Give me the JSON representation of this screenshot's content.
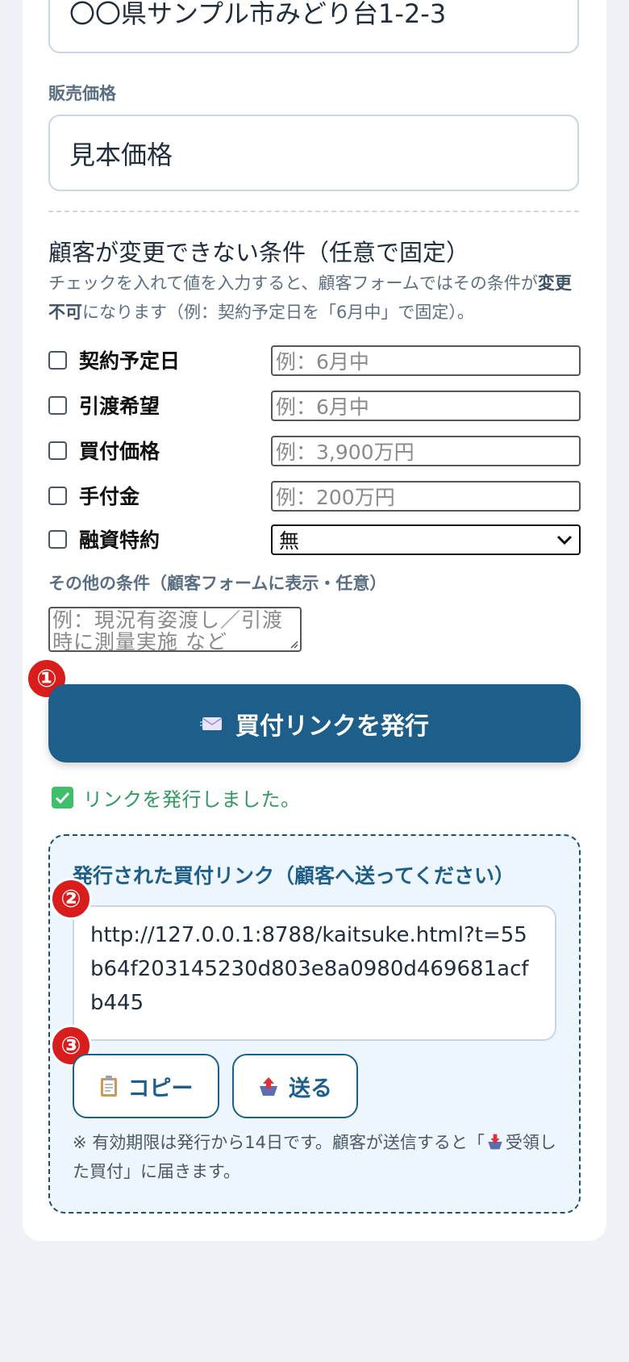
{
  "address_field": {
    "value": "〇〇県サンプル市みどり台1-2-3"
  },
  "price": {
    "label": "販売価格",
    "value": "見本価格"
  },
  "fixed_conditions": {
    "title": "顧客が変更できない条件（任意で固定）",
    "desc_part1": "チェックを入れて値を入力すると、顧客フォームではその条件が",
    "desc_bold": "変更不可",
    "desc_part2": "になります（例：契約予定日を「6月中」で固定）。",
    "items": [
      {
        "label": "契約予定日",
        "placeholder": "例：6月中"
      },
      {
        "label": "引渡希望",
        "placeholder": "例：6月中"
      },
      {
        "label": "買付価格",
        "placeholder": "例：3,900万円"
      },
      {
        "label": "手付金",
        "placeholder": "例：200万円"
      },
      {
        "label": "融資特約",
        "select_value": "無"
      }
    ]
  },
  "other_conditions": {
    "label": "その他の条件（顧客フォームに表示・任意）",
    "placeholder": "例：現況有姿渡し／引渡時に測量実施 など"
  },
  "badges": {
    "one": "①",
    "two": "②",
    "three": "③"
  },
  "issue_button": {
    "label": "買付リンクを発行",
    "icon": "envelope-icon"
  },
  "status": {
    "text": "リンクを発行しました。",
    "icon": "check-icon"
  },
  "result": {
    "title": "発行された買付リンク（顧客へ送ってください）",
    "url": "http://127.0.0.1:8788/kaitsuke.html?t=55b64f203145230d803e8a0980d469681acfb445",
    "copy_label": "コピー",
    "send_label": "送る",
    "note_part1": "※ 有効期限は発行から14日です。顧客が送信すると「",
    "note_part2": "受領した買付」に届きます。"
  },
  "colors": {
    "primary": "#1d5f8a",
    "badge": "#d91c1c",
    "success": "#2e9a5f"
  }
}
